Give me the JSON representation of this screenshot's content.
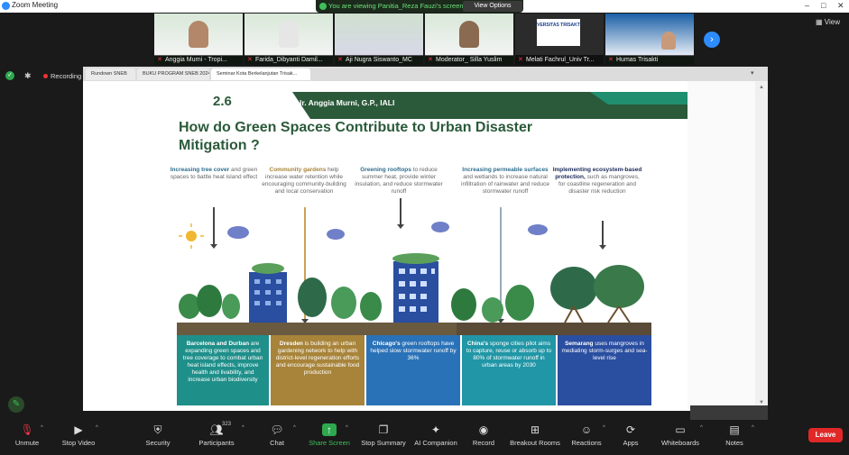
{
  "window": {
    "title": "Zoom Meeting",
    "controls": [
      "–",
      "□",
      "✕"
    ]
  },
  "banner": {
    "text": "You are viewing Panitia_Reza Fauzi's screen",
    "button": "View Options"
  },
  "participants": [
    {
      "name": "Anggia Murni - Tropi..."
    },
    {
      "name": "Farida_Dibyanti Damil..."
    },
    {
      "name": "Aji Nugra Siswanto_MC"
    },
    {
      "name": "Moderator_ Silla Yuslim"
    },
    {
      "name": "Melati Fachrul_Univ Tr..."
    },
    {
      "name": "Humas Trisakti"
    }
  ],
  "thumb_small_text": {
    "univ": "VERSITAS TRISAKT"
  },
  "view_label": "View",
  "recording_label": "Recording",
  "browser_tabs": [
    {
      "label": "Rundown SNEB"
    },
    {
      "label": "BUKU PROGRAM SNEB 2024..."
    },
    {
      "label": "Seminar Kota Berkelanjutan Trisak..."
    }
  ],
  "slide": {
    "number": "2.6",
    "speaker": "Ir. Anggia Murni, G.P., IALI",
    "title": "How do Green Spaces Contribute to Urban Disaster Mitigation ?",
    "columns": [
      {
        "bold": "Increasing tree cover",
        "rest": " and green spaces to battle heat island effect"
      },
      {
        "bold": "Community gardens",
        "rest": " help increase water retention while encouraging community-building and local conservation"
      },
      {
        "bold": "Greening rooftops",
        "rest": " to reduce summer heat, provide winter insulation, and reduce stormwater runoff"
      },
      {
        "bold": "Increasing permeable surfaces",
        "rest": " and wetlands to increase natural infiltration of rainwater and reduce stormwater runoff"
      },
      {
        "bold": "Implementing ecosystem-based protection,",
        "rest": " such as mangroves, for coastline regeneration and disaster risk reduction"
      }
    ],
    "panels": [
      {
        "bold": "Barcelona and Durban",
        "rest": " are expanding green spaces and tree coverage to combat urban heat island effects, improve health and livability, and increase urban biodiversity"
      },
      {
        "bold": "Dresden",
        "rest": " is building an urban gardening network to help with district-level regeneration efforts and encourage sustainable food production"
      },
      {
        "bold": "Chicago's",
        "rest": " green rooftops have helped slow stormwater runoff by 36%"
      },
      {
        "bold": "China's",
        "rest": " sponge cities pilot aims to capture, reuse or absorb up to 80% of stormwater runoff in urban areas by 2030"
      },
      {
        "bold": "Semarang",
        "rest": " uses mangroves in mediating storm-surges and sea-level rise"
      }
    ]
  },
  "toolbar": {
    "items": [
      {
        "label": "Unmute",
        "icon": "mic-muted-icon"
      },
      {
        "label": "Stop Video",
        "icon": "video-icon"
      },
      {
        "label": "Security",
        "icon": "shield-icon"
      },
      {
        "label": "Participants",
        "icon": "participants-icon",
        "count": "323"
      },
      {
        "label": "Chat",
        "icon": "chat-icon"
      },
      {
        "label": "Share Screen",
        "icon": "share-icon"
      },
      {
        "label": "Stop Summary",
        "icon": "summary-icon"
      },
      {
        "label": "AI Companion",
        "icon": "ai-companion-icon"
      },
      {
        "label": "Record",
        "icon": "record-icon"
      },
      {
        "label": "Breakout Rooms",
        "icon": "breakout-icon"
      },
      {
        "label": "Reactions",
        "icon": "reactions-icon"
      },
      {
        "label": "Apps",
        "icon": "apps-icon"
      },
      {
        "label": "Whiteboards",
        "icon": "whiteboard-icon"
      },
      {
        "label": "Notes",
        "icon": "notes-icon"
      }
    ],
    "leave": "Leave"
  },
  "colors": {
    "zoom_blue": "#2d8cff",
    "slide_green": "#2b5a3a",
    "panel_teal": "#1f8f8a",
    "panel_gold": "#a8843a",
    "panel_blue": "#2a72b8",
    "panel_cyan": "#2196a6",
    "panel_navy": "#2a4ea0",
    "leave_red": "#e02828"
  }
}
